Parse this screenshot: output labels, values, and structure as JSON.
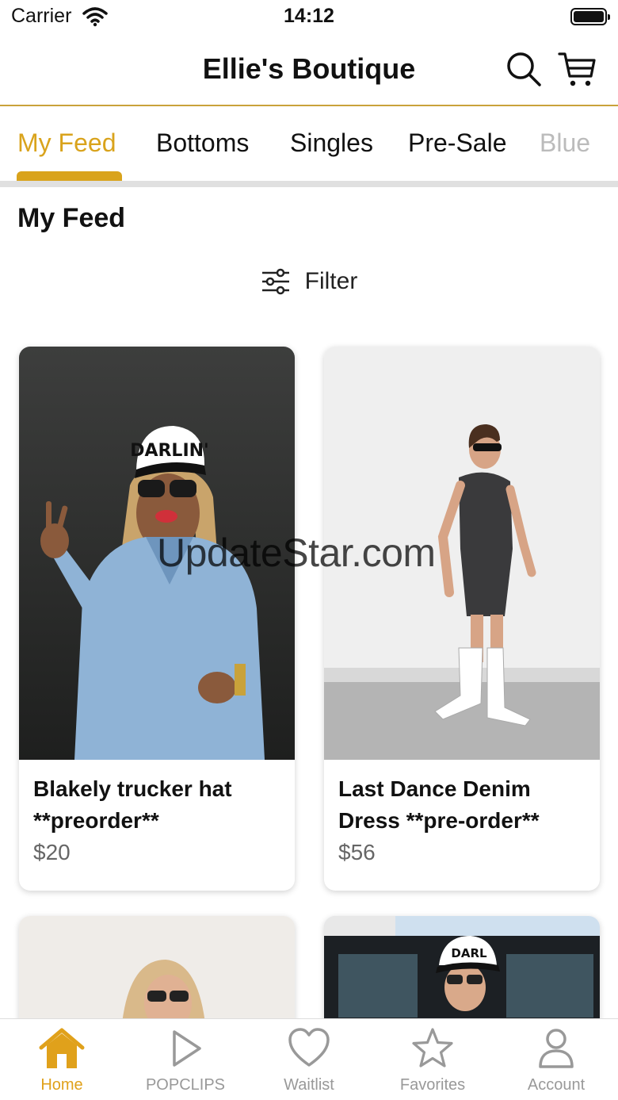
{
  "status_bar": {
    "carrier": "Carrier",
    "time": "14:12"
  },
  "header": {
    "title": "Ellie's Boutique",
    "icons": [
      "search-icon",
      "cart-icon"
    ]
  },
  "tabs": [
    {
      "label": "My Feed",
      "active": true
    },
    {
      "label": "Bottoms",
      "active": false
    },
    {
      "label": "Singles",
      "active": false
    },
    {
      "label": "Pre-Sale",
      "active": false
    },
    {
      "label": "Blue",
      "active": false
    }
  ],
  "section_title": "My Feed",
  "filter": {
    "label": "Filter",
    "icon": "sliders-icon"
  },
  "products": [
    {
      "title_line1": "Blakely trucker hat",
      "title_line2": "**preorder**",
      "price": "$20"
    },
    {
      "title_line1": "Last Dance Denim",
      "title_line2": "Dress **pre-order**",
      "price": "$56"
    }
  ],
  "watermark": "UpdateStar.com",
  "tabbar": [
    {
      "label": "Home",
      "icon": "home-icon",
      "active": true
    },
    {
      "label": "POPCLIPS",
      "icon": "play-icon",
      "active": false
    },
    {
      "label": "Waitlist",
      "icon": "heart-icon",
      "active": false
    },
    {
      "label": "Favorites",
      "icon": "star-icon",
      "active": false
    },
    {
      "label": "Account",
      "icon": "user-icon",
      "active": false
    }
  ],
  "colors": {
    "accent": "#d9a31c",
    "header_border": "#c9a23a",
    "inactive": "#999999"
  }
}
